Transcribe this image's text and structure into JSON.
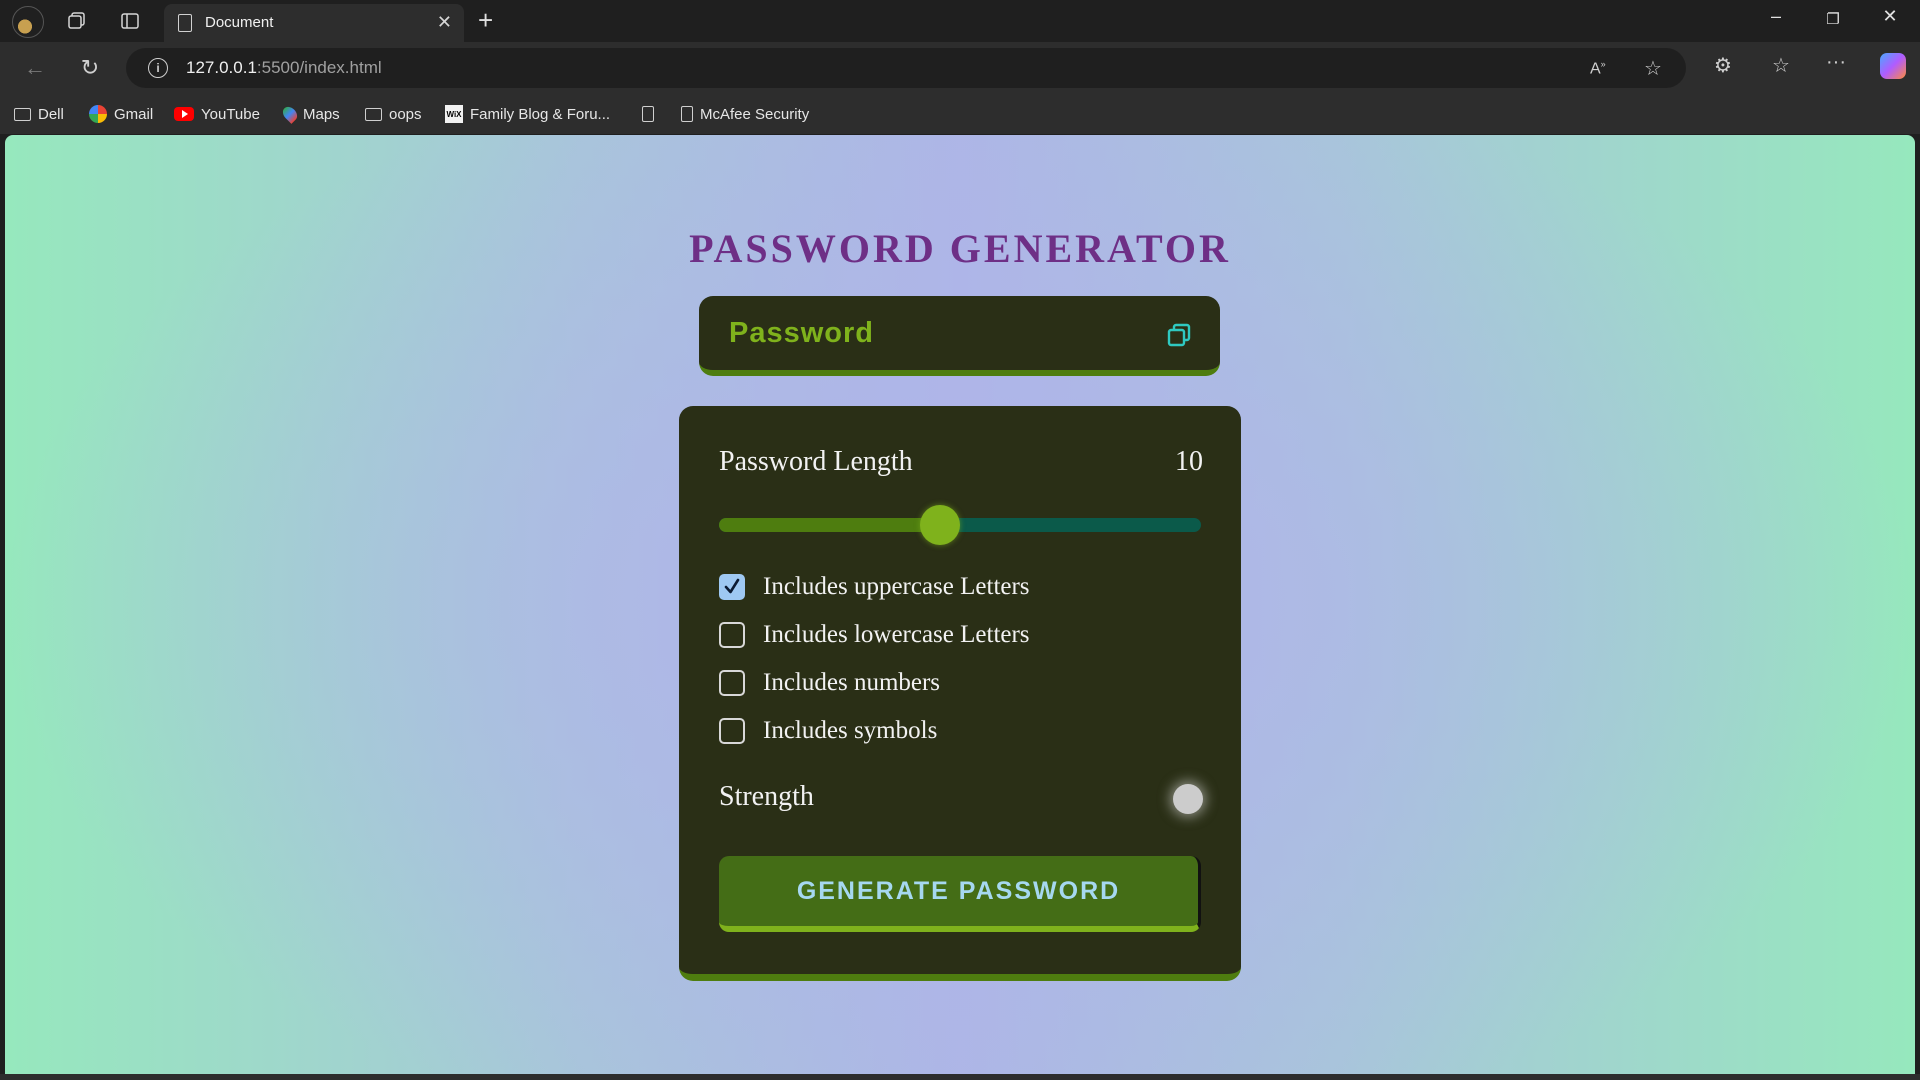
{
  "browser": {
    "tab_title": "Document",
    "url_host": "127.0.0.1",
    "url_path": ":5500/index.html",
    "bookmarks": [
      {
        "label": "Dell",
        "icon": "folder-icon"
      },
      {
        "label": "Gmail",
        "icon": "google-icon"
      },
      {
        "label": "YouTube",
        "icon": "youtube-icon"
      },
      {
        "label": "Maps",
        "icon": "maps-icon"
      },
      {
        "label": "oops",
        "icon": "folder-icon"
      },
      {
        "label": "Family Blog & Foru...",
        "icon": "wix-icon"
      },
      {
        "label": "",
        "icon": "page-icon"
      },
      {
        "label": "McAfee Security",
        "icon": "page-icon"
      }
    ]
  },
  "app": {
    "title": "PASSWORD GENERATOR",
    "display": {
      "placeholder": "Password",
      "value": ""
    },
    "length_label": "Password Length",
    "length_value": "10",
    "slider": {
      "min": 1,
      "max": 20,
      "value": 10
    },
    "options": [
      {
        "label": "Includes uppercase Letters",
        "checked": true
      },
      {
        "label": "Includes lowercase Letters",
        "checked": false
      },
      {
        "label": "Includes numbers",
        "checked": false
      },
      {
        "label": "Includes symbols",
        "checked": false
      }
    ],
    "strength_label": "Strength",
    "strength_color": "#cccccc",
    "generate_label": "GENERATE PASSWORD"
  },
  "colors": {
    "title": "#6e2f86",
    "card_bg": "#2a2f16",
    "accent_green": "#7fb21c",
    "dark_green": "#4e7d0f",
    "track_teal": "#0b5a4a",
    "button_text": "#a6d8f0"
  }
}
